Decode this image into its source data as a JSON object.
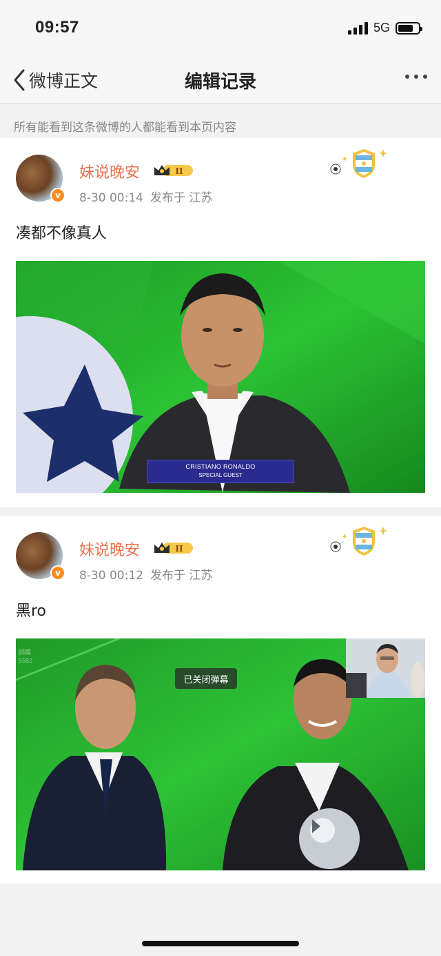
{
  "status_bar": {
    "time": "09:57",
    "network": "5G",
    "battery_level": 0.75
  },
  "nav": {
    "back_label": "微博正文",
    "title": "编辑记录"
  },
  "notice": "所有能看到这条微博的人都能看到本页内容",
  "posts": [
    {
      "username": "妹说晚安",
      "vip_level": "II",
      "time": "8-30 00:14",
      "location": "发布于 江苏",
      "text": "凑都不像真人",
      "image": {
        "caption_name": "CRISTIANO RONALDO",
        "caption_sub": "SPECIAL GUEST"
      }
    },
    {
      "username": "妹说晚安",
      "vip_level": "II",
      "time": "8-30 00:12",
      "location": "发布于 江苏",
      "text": "黑ro",
      "image": {
        "danmaku_label": "已关闭弹幕",
        "stream_tag_1": "鸥模",
        "stream_tag_2": "5582"
      }
    }
  ],
  "colors": {
    "username": "#eb7350",
    "verified": "#f78d1e",
    "pitch_green": "#21a12b"
  },
  "icons": {
    "back": "chevron-left-icon",
    "more": "ellipsis-icon",
    "verified": "verified-v-icon",
    "vip": "crown-badge-icon",
    "fan": "argentina-shield-badge-icon"
  }
}
